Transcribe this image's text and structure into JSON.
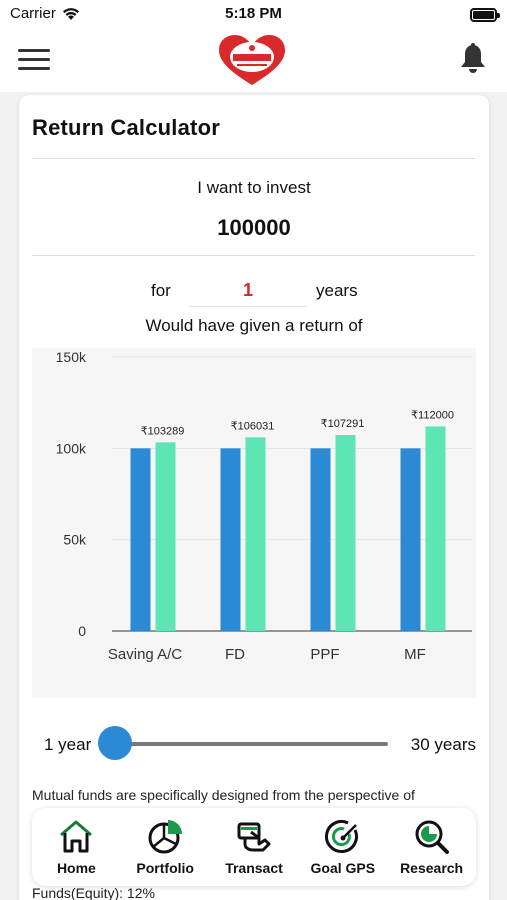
{
  "status_bar": {
    "carrier": "Carrier",
    "time": "5:18 PM"
  },
  "nav": {
    "logo_icon": "company-logo",
    "menu_icon": "hamburger-menu-icon",
    "bell_icon": "bell-icon"
  },
  "calculator": {
    "title": "Return Calculator",
    "invest_label": "I want to invest",
    "invest_amount": "100000",
    "for_label": "for",
    "years_value": "1",
    "years_label": "years",
    "return_label": "Would have given a return of"
  },
  "chart_data": {
    "type": "bar",
    "categories": [
      "Saving A/C",
      "FD",
      "PPF",
      "MF"
    ],
    "series": [
      {
        "values": [
          100000,
          100000,
          100000,
          100000
        ]
      },
      {
        "values": [
          103289,
          106031,
          107291,
          112000
        ]
      }
    ],
    "data_labels": [
      "₹103289",
      "₹106031",
      "₹107291",
      "₹112000"
    ],
    "y_ticks": [
      "0",
      "50k",
      "100k",
      "150k"
    ],
    "ylim": [
      0,
      150000
    ],
    "grid": true,
    "colors": [
      "#2b8ad3",
      "#5ee5b4"
    ]
  },
  "slider": {
    "min_label": "1 year",
    "max_label": "30 years",
    "value": 1,
    "min": 1,
    "max": 30
  },
  "description": {
    "text": "Mutual funds are specifically designed from the perspective of",
    "tail": "Funds(Equity): 12%"
  },
  "tabs": [
    {
      "label": "Home",
      "icon": "home-icon"
    },
    {
      "label": "Portfolio",
      "icon": "pie-chart-icon"
    },
    {
      "label": "Transact",
      "icon": "hand-card-icon"
    },
    {
      "label": "Goal GPS",
      "icon": "target-icon"
    },
    {
      "label": "Research",
      "icon": "magnifier-icon"
    }
  ],
  "colors": {
    "accent": "#2b8ad3",
    "brand_red": "#e0202a",
    "bar_light": "#5ee5b4"
  }
}
